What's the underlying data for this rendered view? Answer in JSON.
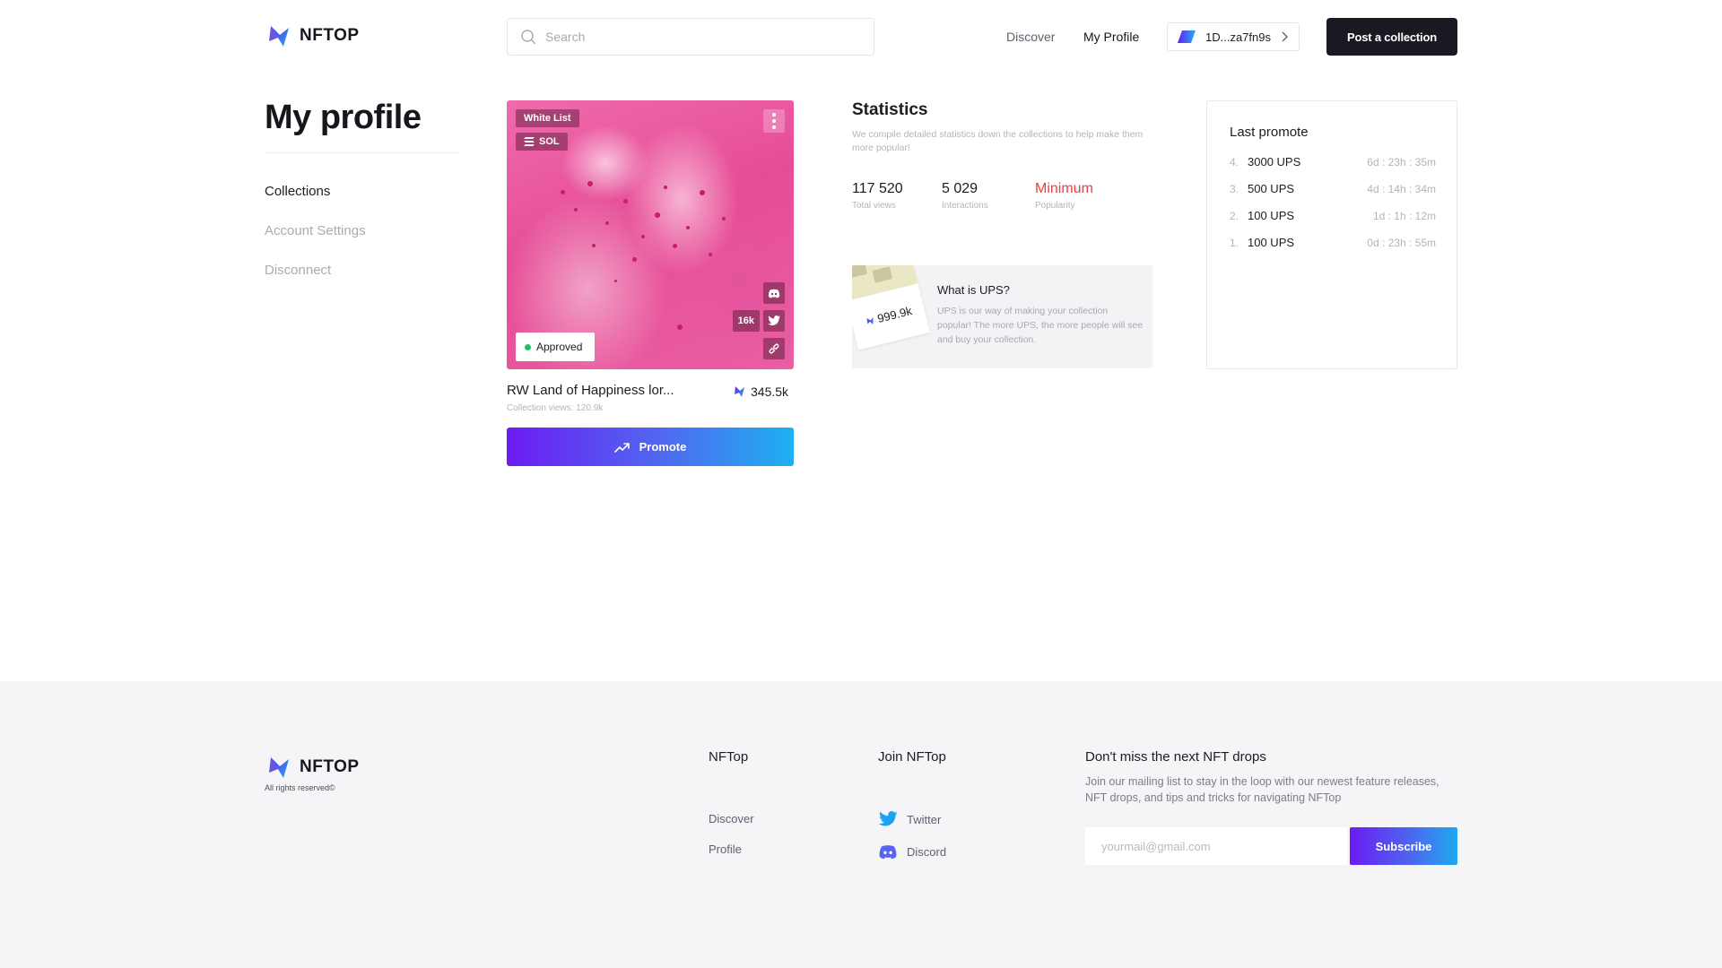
{
  "brand": {
    "name": "NFTOP",
    "accent": "#6c1cf3",
    "accent_end": "#1eb0f0"
  },
  "header": {
    "search_placeholder": "Search",
    "nav": {
      "discover": "Discover",
      "my_profile": "My Profile"
    },
    "wallet": "1D...za7fn9s",
    "post_button": "Post a collection"
  },
  "sidebar": {
    "title": "My profile",
    "items": [
      {
        "label": "Collections",
        "active": true
      },
      {
        "label": "Account Settings",
        "active": false
      },
      {
        "label": "Disconnect",
        "active": false
      }
    ]
  },
  "collection": {
    "tags": {
      "white_list": "White List",
      "chain": "SOL"
    },
    "status": "Approved",
    "twitter_count": "16k",
    "title": "RW Land of Happiness lor...",
    "price": "345.5k",
    "views": "Collection views: 120.9k",
    "promote_label": "Promote"
  },
  "statistics": {
    "title": "Statistics",
    "description": "We compile detailed statistics down the collections to help make them more popular!",
    "stats": [
      {
        "value": "117 520",
        "label": "Total views"
      },
      {
        "value": "5 029",
        "label": "Interactions"
      },
      {
        "value": "Minimum",
        "label": "Popularity"
      }
    ],
    "popularity_color": "#ea3e3e",
    "ups": {
      "card_value": "999.9k",
      "title": "What is UPS?",
      "text": "UPS is our way of making your collection popular! The more UPS, the more people will see and buy your collection."
    }
  },
  "last_promote": {
    "title": "Last promote",
    "rows": [
      {
        "index": "4.",
        "amount": "3000 UPS",
        "time": "6d : 23h : 35m"
      },
      {
        "index": "3.",
        "amount": "500 UPS",
        "time": "4d : 14h : 34m"
      },
      {
        "index": "2.",
        "amount": "100 UPS",
        "time": "1d : 1h : 12m"
      },
      {
        "index": "1.",
        "amount": "100 UPS",
        "time": "0d : 23h : 55m"
      }
    ]
  },
  "footer": {
    "rights": "All rights reserved©",
    "nftop_heading": "NFTop",
    "join_heading": "Join NFTop",
    "links": {
      "discover": "Discover",
      "profile": "Profile"
    },
    "social": {
      "twitter": "Twitter",
      "discord": "Discord"
    },
    "newsletter": {
      "title": "Don't miss the next NFT drops",
      "text": "Join our mailing list to stay in the loop with our newest feature releases, NFT drops, and tips and tricks for navigating NFTop",
      "placeholder": "yourmail@gmail.com",
      "button": "Subscribe"
    }
  }
}
